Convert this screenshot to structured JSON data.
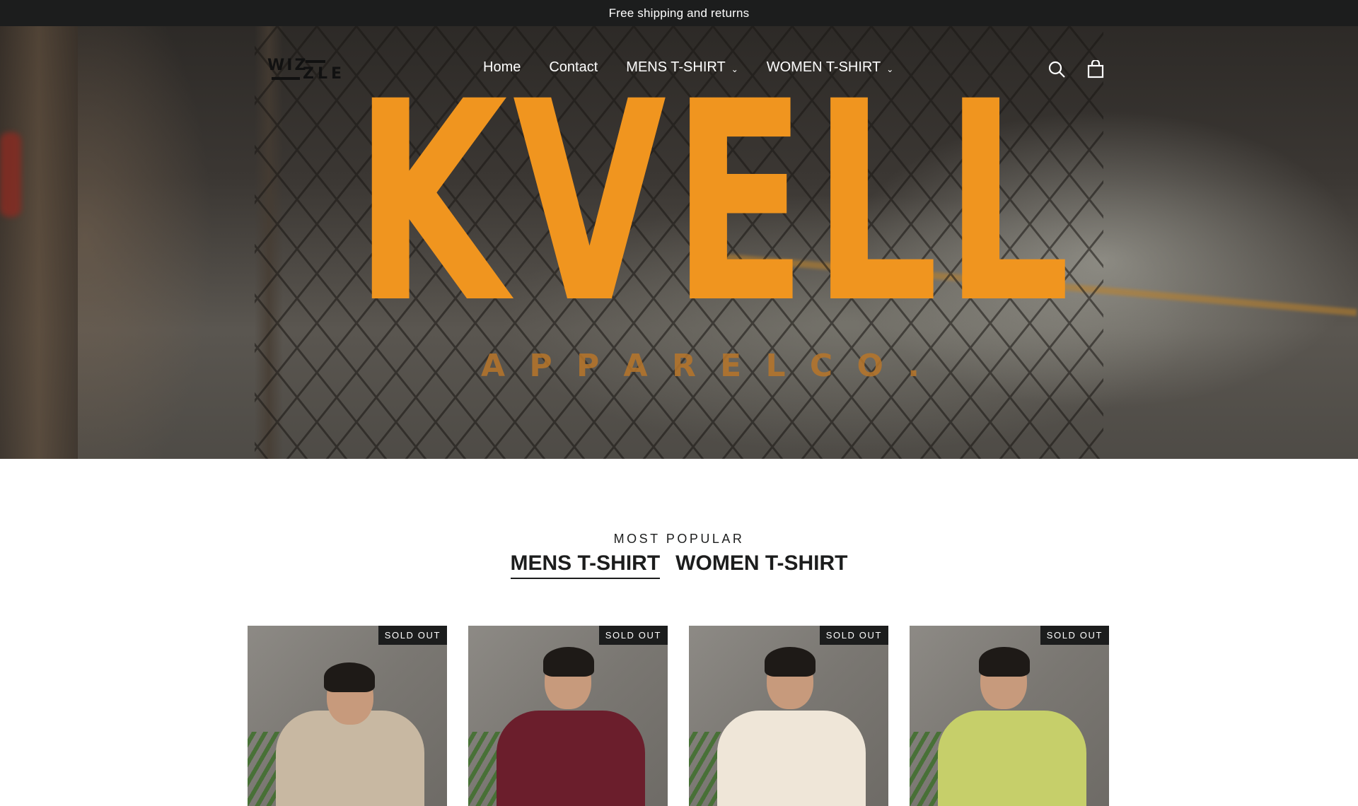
{
  "announcement": {
    "text": "Free shipping and returns"
  },
  "header": {
    "logo_line1": "WIZ",
    "logo_line2": "ZLE",
    "nav": [
      {
        "label": "Home",
        "has_dropdown": false
      },
      {
        "label": "Contact",
        "has_dropdown": false
      },
      {
        "label": "MENS T-SHIRT",
        "has_dropdown": true
      },
      {
        "label": "WOMEN T-SHIRT",
        "has_dropdown": true
      }
    ],
    "icons": [
      "search-icon",
      "cart-icon"
    ]
  },
  "hero": {
    "brand_letters": [
      "K",
      "V",
      "E",
      "L",
      "L"
    ],
    "subtitle_letters": [
      "A",
      "P",
      "P",
      "A",
      "R",
      "E",
      "L",
      "C",
      "O",
      "."
    ]
  },
  "collection": {
    "label": "MOST POPULAR",
    "tabs": [
      {
        "label": "MENS T-SHIRT",
        "active": true
      },
      {
        "label": "WOMEN T-SHIRT",
        "active": false
      }
    ]
  },
  "products": [
    {
      "badge": "SOLD OUT",
      "shirt_color": "#c8b8a2"
    },
    {
      "badge": "SOLD OUT",
      "shirt_color": "#6b1e2c"
    },
    {
      "badge": "SOLD OUT",
      "shirt_color": "#efe6d8"
    },
    {
      "badge": "SOLD OUT",
      "shirt_color": "#c6cf6a"
    }
  ],
  "colors": {
    "announcement_bg": "#1c1d1d",
    "brand_orange": "#f0951f",
    "text_dark": "#1c1d1d",
    "badge_bg": "#1c1d1d"
  }
}
